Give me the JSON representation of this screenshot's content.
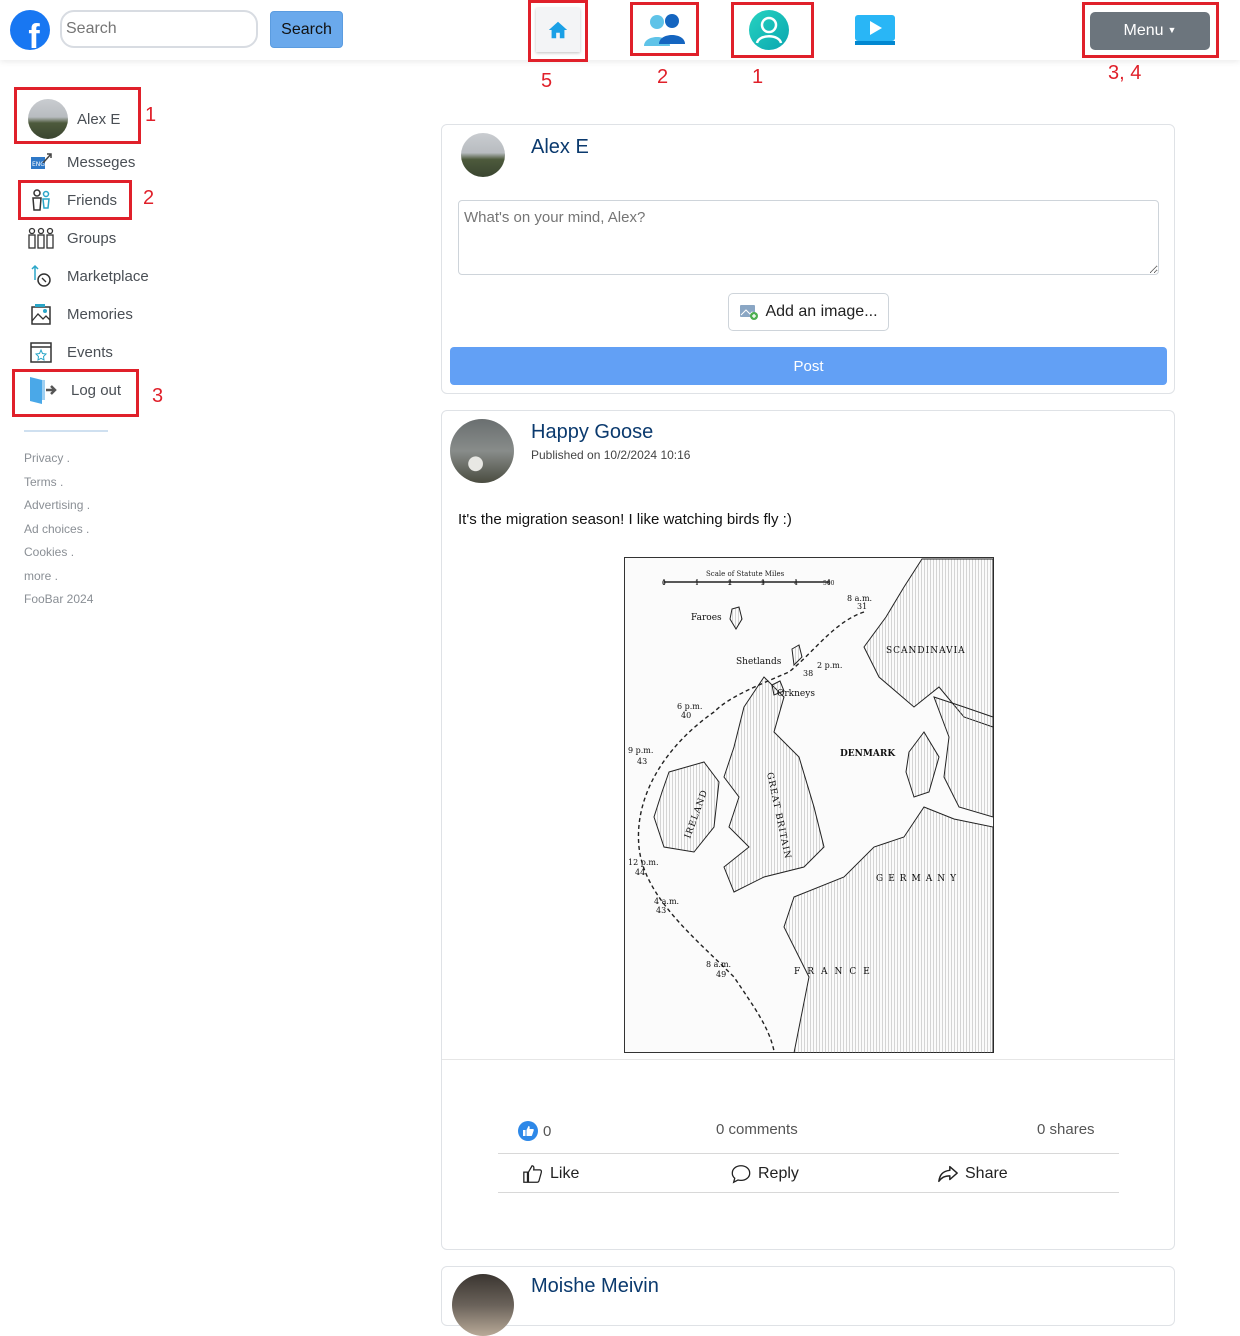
{
  "topbar": {
    "logo_letter": "f",
    "search_placeholder": "Search",
    "search_button": "Search",
    "menu_label": "Menu",
    "nav_icons": [
      "home-icon",
      "friends-icon",
      "profile-icon",
      "watch-icon"
    ]
  },
  "annotations": {
    "home": "5",
    "friends_nav": "2",
    "profile_nav": "1",
    "menu": "3, 4",
    "side_profile": "1",
    "side_friends": "2",
    "side_logout": "3"
  },
  "sidebar": {
    "profile_name": "Alex E",
    "items": [
      {
        "label": "Messeges",
        "icon": "messages-icon"
      },
      {
        "label": "Friends",
        "icon": "friends-icon"
      },
      {
        "label": "Groups",
        "icon": "groups-icon"
      },
      {
        "label": "Marketplace",
        "icon": "marketplace-icon"
      },
      {
        "label": "Memories",
        "icon": "memories-icon"
      },
      {
        "label": "Events",
        "icon": "events-icon"
      },
      {
        "label": "Log out",
        "icon": "logout-icon"
      }
    ],
    "footer": [
      "Privacy .",
      "Terms .",
      "Advertising .",
      "Ad choices .",
      "Cookies .",
      "more .",
      "FooBar 2024"
    ]
  },
  "composer": {
    "author": "Alex E",
    "placeholder": "What's on your mind, Alex?",
    "add_image": "Add an image...",
    "post_button": "Post"
  },
  "post": {
    "author": "Happy Goose",
    "published": "Published on 10/2/2024 10:16",
    "text": "It's the migration season! I like watching birds fly :)",
    "likes": "0",
    "comments": "0 comments",
    "shares": "0 shares",
    "like_label": "Like",
    "reply_label": "Reply",
    "share_label": "Share"
  },
  "map": {
    "scale_title": "Scale of Statute Miles",
    "scale_ticks": [
      "0",
      "1",
      "2",
      "3",
      "4",
      "500"
    ],
    "places": [
      "Faroes",
      "Shetlands",
      "Orkneys",
      "SCANDINAVIA",
      "DENMARK",
      "IRELAND",
      "GREAT BRITAIN",
      "GERMANY",
      "FRANCE"
    ],
    "times": [
      {
        "t": "8 a.m.",
        "n": "31"
      },
      {
        "t": "2 p.m.",
        "n": "38"
      },
      {
        "t": "6 p.m.",
        "n": "40"
      },
      {
        "t": "9 p.m.",
        "n": "43"
      },
      {
        "t": "12 p.m.",
        "n": "44"
      },
      {
        "t": "4 a.m.",
        "n": "43"
      },
      {
        "t": "8 a.m.",
        "n": "49"
      }
    ]
  },
  "next_post": {
    "author": "Moishe Meivin"
  },
  "colors": {
    "brand": "#1877f2",
    "post_button": "#62a0f5",
    "annotation": "#e0202a",
    "name_link": "#0b3a6e"
  }
}
